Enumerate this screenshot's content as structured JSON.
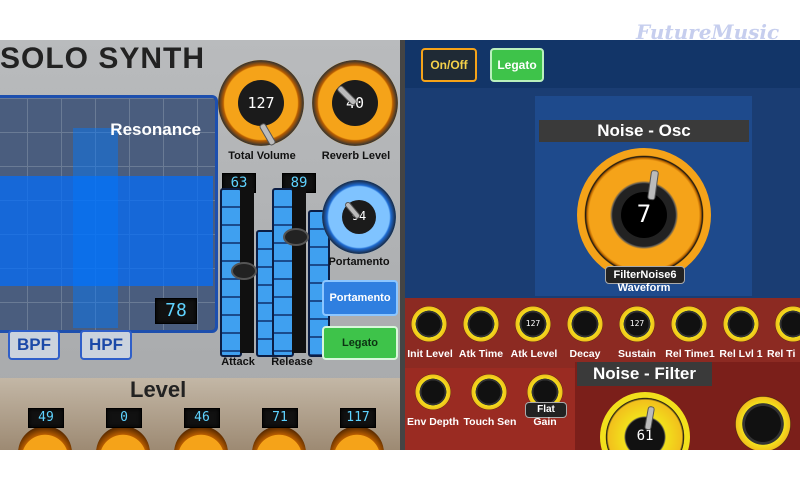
{
  "watermark": "FutureMusic",
  "left_panel": {
    "title": "SOLO SYNTH",
    "xy_pad": {
      "label": "Resonance",
      "value": "78"
    },
    "filter_buttons": [
      "BPF",
      "HPF"
    ],
    "knobs": {
      "total_volume": {
        "label": "Total Volume",
        "value": "127"
      },
      "reverb_level": {
        "label": "Reverb Level",
        "value": "40"
      },
      "portamento": {
        "label": "Portamento",
        "value": "94"
      }
    },
    "sliders": {
      "attack": {
        "label": "Attack",
        "value": "63"
      },
      "release": {
        "label": "Release",
        "value": "89"
      }
    },
    "buttons": {
      "portamento": "Portamento",
      "legato": "Legato"
    },
    "level": {
      "title": "Level",
      "values": [
        "49",
        "0",
        "46",
        "71",
        "117"
      ]
    }
  },
  "right_panel": {
    "top_buttons": {
      "onoff": "On/Off",
      "legato": "Legato"
    },
    "noise_osc": {
      "title": "Noise - Osc",
      "value": "7",
      "selector": "FilterNoise6",
      "label": "Waveform"
    },
    "envelope_knobs": [
      {
        "label": "Init Level",
        "value": ""
      },
      {
        "label": "Atk Time",
        "value": ""
      },
      {
        "label": "Atk Level",
        "value": "127"
      },
      {
        "label": "Decay",
        "value": ""
      },
      {
        "label": "Sustain",
        "value": "127"
      },
      {
        "label": "Rel Time1",
        "value": ""
      },
      {
        "label": "Rel Lvl 1",
        "value": ""
      },
      {
        "label": "Rel Ti",
        "value": ""
      }
    ],
    "filter_knobs": [
      {
        "label": "Env Depth",
        "value": ""
      },
      {
        "label": "Touch Sen",
        "value": ""
      },
      {
        "label": "Gain",
        "value": "Flat"
      }
    ],
    "noise_filter": {
      "title": "Noise - Filter",
      "value": "61"
    }
  },
  "colors": {
    "accent_orange": "#f5a319",
    "accent_blue": "#2f7fe0",
    "knob_yellow": "#f2e01c",
    "panel_red": "#9a2b22"
  }
}
